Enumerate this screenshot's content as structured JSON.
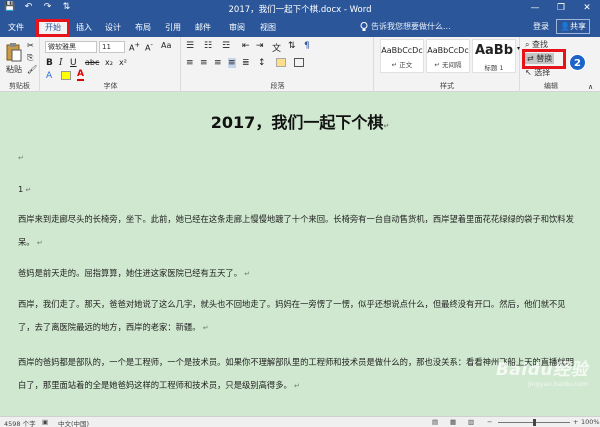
{
  "window": {
    "title": "2017，我们一起下个棋.docx - Word",
    "controls": [
      "—",
      "❐",
      "✕"
    ],
    "qat": [
      "💾",
      "↶",
      "↷",
      "⇅"
    ]
  },
  "tabs": [
    {
      "label": "文件",
      "active": false
    },
    {
      "label": "开始",
      "active": true
    },
    {
      "label": "插入",
      "active": false
    },
    {
      "label": "设计",
      "active": false
    },
    {
      "label": "布局",
      "active": false
    },
    {
      "label": "引用",
      "active": false
    },
    {
      "label": "邮件",
      "active": false
    },
    {
      "label": "审阅",
      "active": false
    },
    {
      "label": "视图",
      "active": false
    }
  ],
  "tellme": "告诉我您想要做什么...",
  "login_label": "登录",
  "share_label": "共享",
  "badges": {
    "one": "1",
    "two": "2"
  },
  "ribbon": {
    "clipboard": {
      "label": "剪贴板",
      "paste": "粘贴"
    },
    "font": {
      "label": "字体",
      "name": "微软雅黑",
      "size": "11",
      "bold": "B",
      "italic": "I",
      "underline": "U"
    },
    "paragraph": {
      "label": "段落"
    },
    "styles": {
      "label": "样式",
      "items": [
        {
          "preview": "AaBbCcDc",
          "name": "↵ 正文"
        },
        {
          "preview": "AaBbCcDc",
          "name": "↵ 无间隔"
        },
        {
          "preview": "AaBb",
          "name": "标题 1"
        }
      ]
    },
    "editing": {
      "label": "编辑",
      "find": "查找",
      "replace": "替换",
      "select": "选择"
    }
  },
  "document": {
    "heading": "2017，我们一起下个棋",
    "paragraphs": [
      "1",
      "西岸来到走廊尽头的长椅旁，坐下。此前，她已经在这条走廊上慢慢地踱了十个来回。长椅旁有一台自动售货机，西岸望着里面花花绿绿的袋子和饮料发呆。",
      "爸妈是前天走的。屈指算算，她住进这家医院已经有五天了。",
      "西岸，我们走了。那天，爸爸对她说了这么几字，就头也不回地走了。妈妈在一旁愣了一愣，似乎还想说点什么，但最终没有开口。然后，他们就不见了，去了离医院最远的地方，西岸的老家：新疆。",
      "西岸的爸妈都是部队的，一个是工程师，一个是技术员。如果你不理解部队里的工程师和技术员是做什么的，那也没关系：看看神州飞船上天的直播就明白了，那里面站着的全是她爸妈这样的工程师和技术员，只是级别高得多。"
    ]
  },
  "statusbar": {
    "words": "4598 个字",
    "lang": "中文(中国)",
    "zoom": "100%",
    "zoom_level": 0.5
  },
  "watermark": {
    "main": "Baidu经验",
    "sub": "jingyan.baidu.com"
  }
}
